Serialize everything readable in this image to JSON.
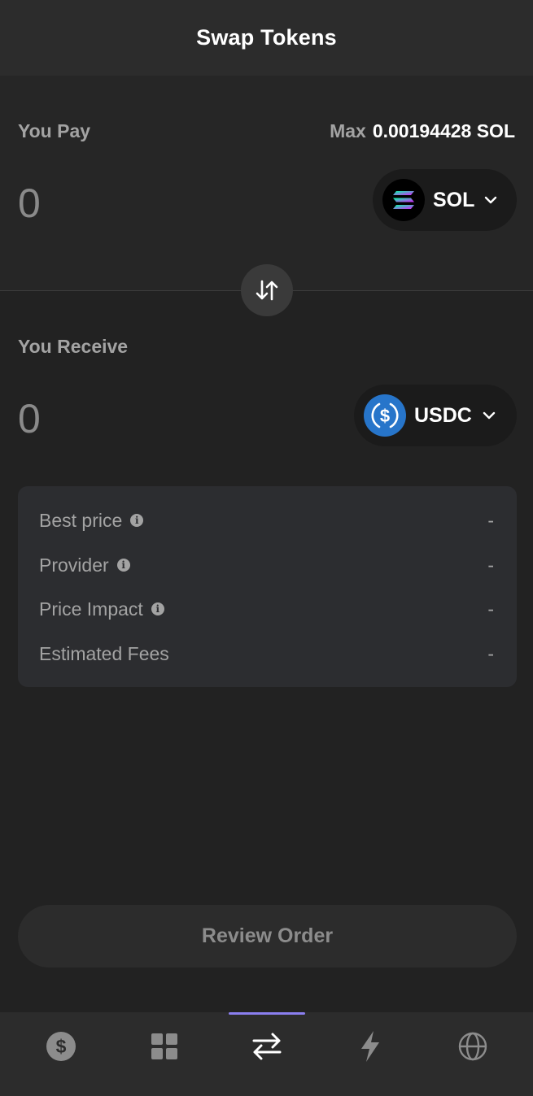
{
  "header": {
    "title": "Swap Tokens"
  },
  "pay": {
    "label": "You Pay",
    "max_label": "Max",
    "max_value": "0.00194428 SOL",
    "amount": "0",
    "token": {
      "symbol": "SOL",
      "icon": "solana-logo-icon"
    }
  },
  "receive": {
    "label": "You Receive",
    "amount": "0",
    "token": {
      "symbol": "USDC",
      "icon": "usdc-logo-icon"
    }
  },
  "info": {
    "rows": [
      {
        "label": "Best price",
        "value": "-",
        "has_info": true
      },
      {
        "label": "Provider",
        "value": "-",
        "has_info": true
      },
      {
        "label": "Price Impact",
        "value": "-",
        "has_info": true
      },
      {
        "label": "Estimated Fees",
        "value": "-",
        "has_info": false
      }
    ],
    "info_glyph": "i"
  },
  "review_button": {
    "label": "Review Order"
  },
  "nav": {
    "items": [
      {
        "icon": "dollar-circle-icon",
        "active": false
      },
      {
        "icon": "grid-icon",
        "active": false
      },
      {
        "icon": "swap-arrows-icon",
        "active": true
      },
      {
        "icon": "lightning-icon",
        "active": false
      },
      {
        "icon": "globe-icon",
        "active": false
      }
    ],
    "accent": "#8b7ff0"
  },
  "colors": {
    "background": "#222222",
    "header": "#2c2c2c",
    "muted_text": "#a3a3a3",
    "usdc_blue": "#2775ca"
  }
}
